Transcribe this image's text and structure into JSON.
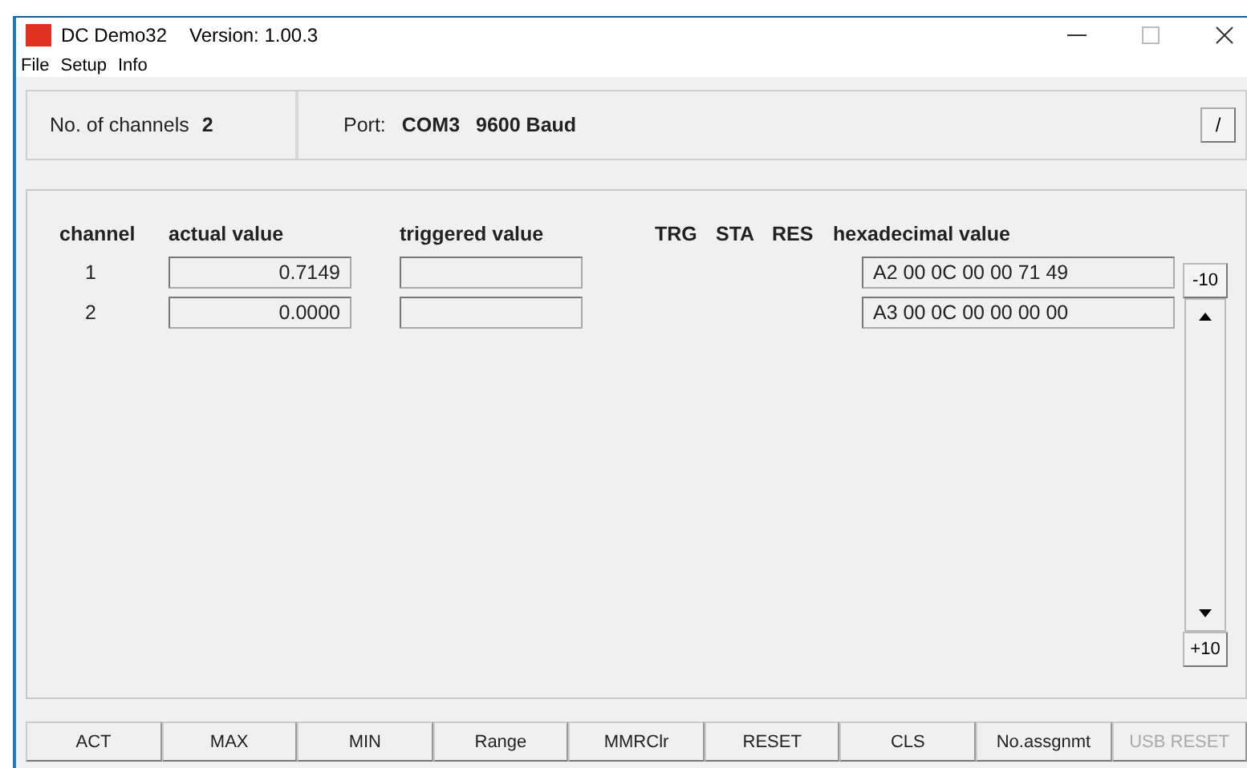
{
  "window": {
    "title": "DC Demo32",
    "version": "Version: 1.00.3"
  },
  "menu": [
    "File",
    "Setup",
    "Info"
  ],
  "info": {
    "channels_label": "No. of channels",
    "channels_value": "2",
    "port_label": "Port:",
    "port": "COM3",
    "baud": "9600 Baud",
    "edit_button": "/"
  },
  "table": {
    "columns": [
      "channel",
      "actual value",
      "triggered value",
      "TRG",
      "STA",
      "RES",
      "hexadecimal value"
    ],
    "rows": [
      {
        "channel": "1",
        "actual": "0.7149",
        "hex": "A2 00 0C 00 00 71 49"
      },
      {
        "channel": "2",
        "actual": "0.0000",
        "hex": "A3 00 0C 00 00 00 00"
      }
    ]
  },
  "scroll": {
    "minus": "-10",
    "plus": "+10"
  },
  "buttons": [
    {
      "label": "ACT",
      "disabled": false
    },
    {
      "label": "MAX",
      "disabled": false
    },
    {
      "label": "MIN",
      "disabled": false
    },
    {
      "label": "Range",
      "disabled": false
    },
    {
      "label": "MMRClr",
      "disabled": false
    },
    {
      "label": "RESET",
      "disabled": false
    },
    {
      "label": "CLS",
      "disabled": false
    },
    {
      "label": "No.assgnmt",
      "disabled": false
    },
    {
      "label": "USB RESET",
      "disabled": true
    }
  ]
}
